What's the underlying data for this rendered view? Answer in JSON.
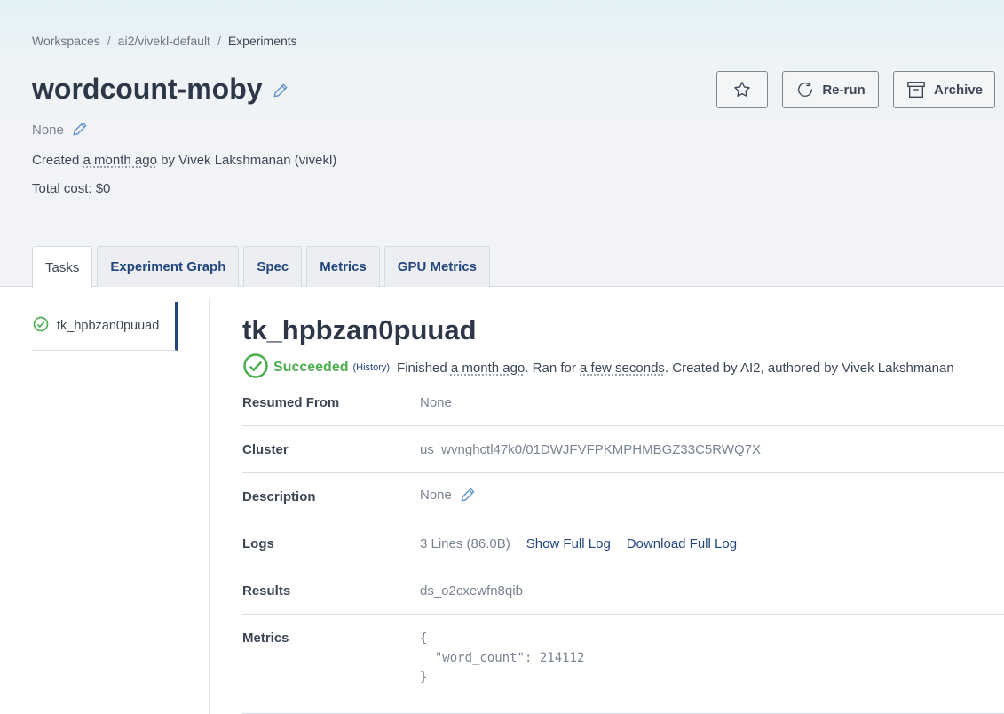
{
  "breadcrumb": {
    "workspaces": "Workspaces",
    "sep1": "/",
    "workspace": "ai2/vivekl-default",
    "sep2": "/",
    "current": "Experiments"
  },
  "experiment": {
    "name": "wordcount-moby",
    "description": "None",
    "created_prefix": "Created",
    "created_rel": "a month ago",
    "created_suffix": "by Vivek Lakshmanan (vivekl)",
    "total_cost": "Total cost: $0"
  },
  "actions": {
    "rerun": "Re-run",
    "archive": "Archive"
  },
  "tabs": [
    {
      "label": "Tasks"
    },
    {
      "label": "Experiment Graph"
    },
    {
      "label": "Spec"
    },
    {
      "label": "Metrics"
    },
    {
      "label": "GPU Metrics"
    }
  ],
  "sidebar": {
    "task": "tk_hpbzan0puuad"
  },
  "task": {
    "title": "tk_hpbzan0puuad",
    "status": "Succeeded",
    "history": "(History)",
    "finished_prefix": "Finished",
    "finished_rel": "a month ago",
    "ran_prefix": ". Ran for",
    "ran_rel": "a few seconds",
    "created_text": ". Created by AI2, authored by Vivek Lakshmanan"
  },
  "details": {
    "resumed_label": "Resumed From",
    "resumed_value": "None",
    "cluster_label": "Cluster",
    "cluster_value": "us_wvnghctl47k0/01DWJFVFPKMPHMBGZ33C5RWQ7X",
    "description_label": "Description",
    "description_value": "None",
    "logs_label": "Logs",
    "logs_size": "3 Lines (86.0B)",
    "logs_show": "Show Full Log",
    "logs_download": "Download Full Log",
    "results_label": "Results",
    "results_value": "ds_o2cxewfn8qib",
    "metrics_label": "Metrics",
    "metrics_value": "{\n  \"word_count\": 214112\n}"
  },
  "colors": {
    "accent": "#24467f",
    "success": "#4cae4f",
    "header_bg": "#f2f3f6"
  }
}
